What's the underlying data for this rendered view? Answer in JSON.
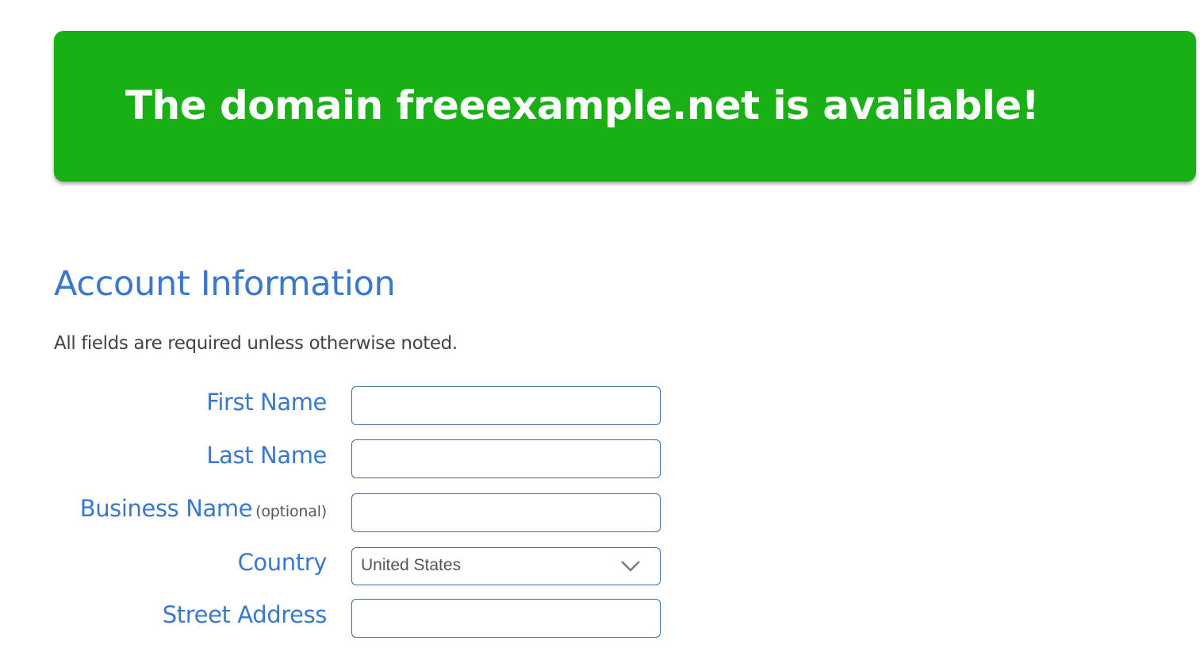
{
  "banner": {
    "message": "The domain freeexample.net is available!",
    "color": "#19b015"
  },
  "account": {
    "title": "Account Information",
    "note": "All fields are required unless otherwise noted.",
    "fields": [
      {
        "label": "First Name",
        "value": "",
        "type": "text"
      },
      {
        "label": "Last Name",
        "value": "",
        "type": "text"
      },
      {
        "label": "Business Name",
        "optional_tag": "(optional)",
        "value": "",
        "type": "text"
      },
      {
        "label": "Country",
        "value": "United States",
        "type": "select",
        "icon": "chevron-down-icon"
      },
      {
        "label": "Street Address",
        "value": "",
        "type": "text"
      }
    ]
  },
  "colors": {
    "accent_blue": "#3a78d0",
    "input_border": "#3a6fa8",
    "body_text": "#444444"
  }
}
